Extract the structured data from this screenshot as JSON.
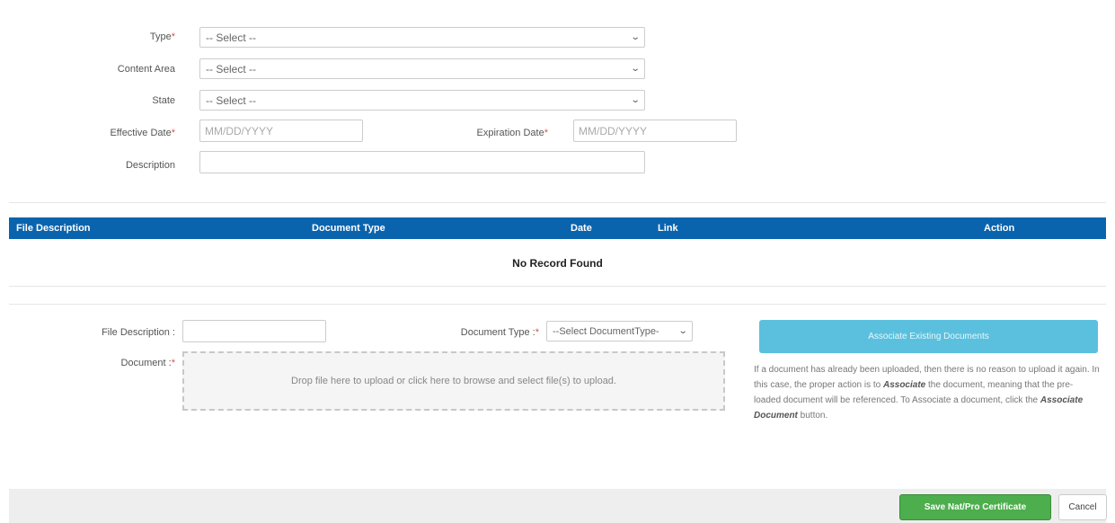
{
  "form": {
    "type": {
      "label": "Type",
      "value": "-- Select --"
    },
    "content_area": {
      "label": "Content Area",
      "value": "-- Select --"
    },
    "state": {
      "label": "State",
      "value": "-- Select --"
    },
    "effective_date": {
      "label": "Effective Date",
      "placeholder": "MM/DD/YYYY"
    },
    "expiration_date": {
      "label": "Expiration Date",
      "placeholder": "MM/DD/YYYY"
    },
    "description": {
      "label": "Description",
      "value": ""
    },
    "required_marker": "*"
  },
  "table": {
    "columns": [
      "File Description",
      "Document Type",
      "Date",
      "Link",
      "Action"
    ],
    "empty_message": "No Record Found"
  },
  "upload": {
    "file_description_label": "File Description :",
    "document_type_label": "Document Type :",
    "document_type_value": "--Select DocumentType-",
    "document_label": "Document :",
    "dropzone_text": "Drop file here to upload or click here to browse and select file(s) to upload.",
    "associate_button": "Associate Existing Documents",
    "help_text": {
      "p1": "If a document has already been uploaded, then there is no reason to upload it again. In this case, the proper action is to ",
      "associate_word": "Associate",
      "p2": " the document, meaning that the pre-loaded document will be referenced. To Associate a document, click the ",
      "button_name": "Associate Document",
      "p3": " button."
    }
  },
  "footer": {
    "save_button": "Save Nat/Pro Certificate",
    "cancel_button": "Cancel"
  },
  "colors": {
    "table_header": "#0a63ad",
    "associate_button": "#5bc0de",
    "save_button": "#4cae4c",
    "required": "#d9534f"
  }
}
